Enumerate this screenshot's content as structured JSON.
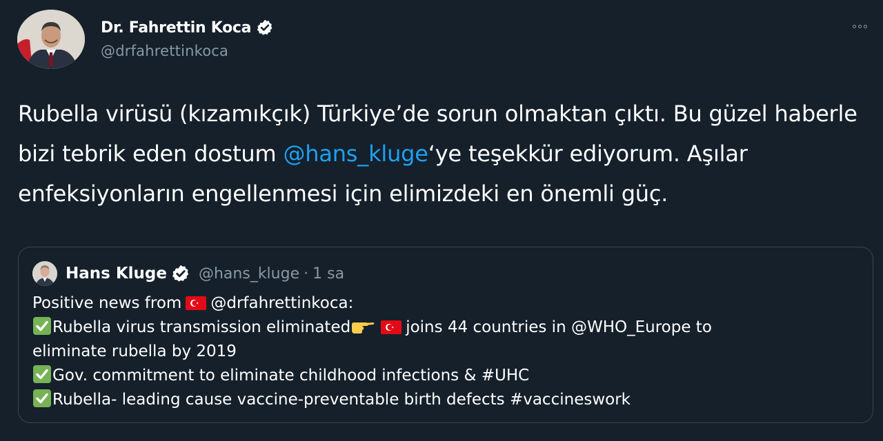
{
  "author": {
    "name": "Dr. Fahrettin Koca",
    "handle": "@drfahrettinkoca",
    "verified": true
  },
  "tweet": {
    "part1": "Rubella virüsü (kızamıkçık) Türkiye’de sorun olmaktan çıktı. Bu güzel haberle bizi tebrik eden dostum ",
    "mention": "@hans_kluge",
    "part2": "‘ye teşekkür ediyorum. Aşılar enfeksiyonların engellenmesi için elimizdeki en önemli güç."
  },
  "quoted_tweet": {
    "name": "Hans Kluge",
    "handle": "@hans_kluge",
    "separator": "·",
    "time": "1 sa",
    "verified": true,
    "line1_a": "Positive news from",
    "line1_b": "@drfahrettinkoca:",
    "line2_a": "Rubella virus transmission eliminated",
    "line2_b": "joins 44 countries in @WHO_Europe to",
    "line3": "eliminate rubella by 2019",
    "line4": "Gov. commitment to eliminate childhood infections & #UHC",
    "line5": "Rubella- leading cause vaccine-preventable birth defects #vaccineswork"
  },
  "icons": {
    "verified": "verified-badge-icon",
    "more": "more-options-icon",
    "flag": "turkey-flag-icon",
    "check": "check-mark-icon",
    "hand": "pointing-hand-icon"
  },
  "colors": {
    "background": "#15202b",
    "mention": "#1da1f2",
    "secondary_text": "#8899a6",
    "border": "#38444d",
    "check_green": "#77b255",
    "flag_red": "#e30a17"
  }
}
